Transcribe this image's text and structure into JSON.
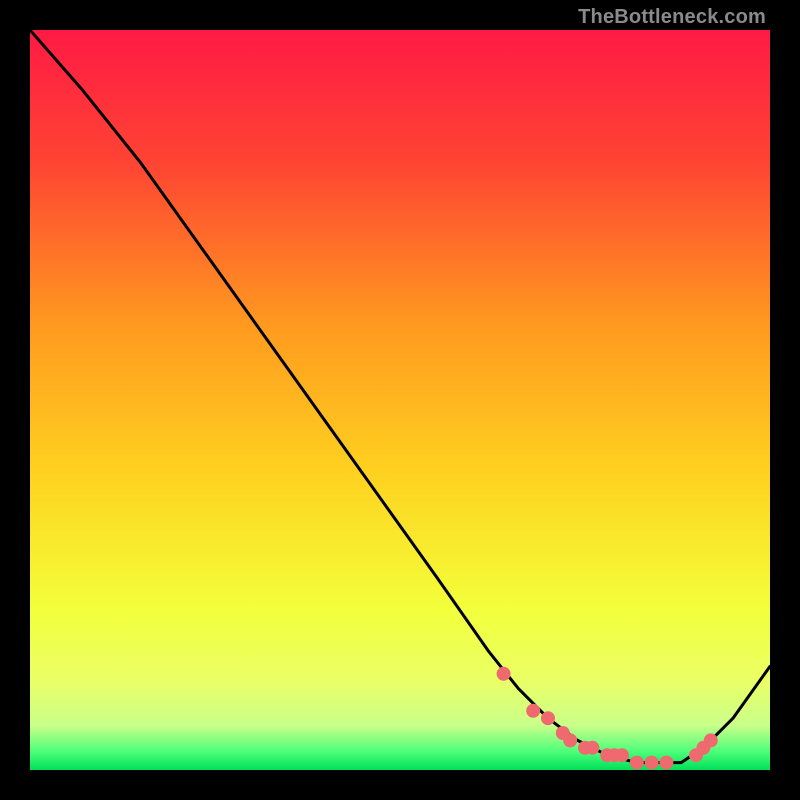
{
  "attribution": "TheBottleneck.com",
  "chart_data": {
    "type": "line",
    "title": "",
    "xlabel": "",
    "ylabel": "",
    "xlim": [
      0,
      100
    ],
    "ylim": [
      0,
      100
    ],
    "series": [
      {
        "name": "curve",
        "x": [
          0,
          7,
          15,
          25,
          35,
          45,
          55,
          62,
          66,
          70,
          74,
          78,
          82,
          85,
          88,
          91,
          95,
          100
        ],
        "y": [
          100,
          92,
          82,
          68,
          54,
          40,
          26,
          16,
          11,
          7,
          4,
          2,
          1,
          1,
          1,
          3,
          7,
          14
        ]
      }
    ],
    "markers": {
      "name": "highlighted-points",
      "x": [
        64,
        68,
        70,
        72,
        73,
        75,
        76,
        78,
        79,
        80,
        82,
        84,
        86,
        90,
        91,
        92
      ],
      "y": [
        13,
        8,
        7,
        5,
        4,
        3,
        3,
        2,
        2,
        2,
        1,
        1,
        1,
        2,
        3,
        4
      ]
    },
    "gradient_stops": [
      {
        "offset": 0.0,
        "color": "#ff1a44"
      },
      {
        "offset": 0.18,
        "color": "#ff4433"
      },
      {
        "offset": 0.4,
        "color": "#ff9a1f"
      },
      {
        "offset": 0.6,
        "color": "#ffd21f"
      },
      {
        "offset": 0.78,
        "color": "#f3ff3a"
      },
      {
        "offset": 0.88,
        "color": "#eaff66"
      },
      {
        "offset": 0.94,
        "color": "#c9ff8a"
      },
      {
        "offset": 0.975,
        "color": "#4dff7a"
      },
      {
        "offset": 1.0,
        "color": "#00e05a"
      }
    ],
    "marker_color": "#ef6a6f",
    "line_color": "#000000"
  }
}
